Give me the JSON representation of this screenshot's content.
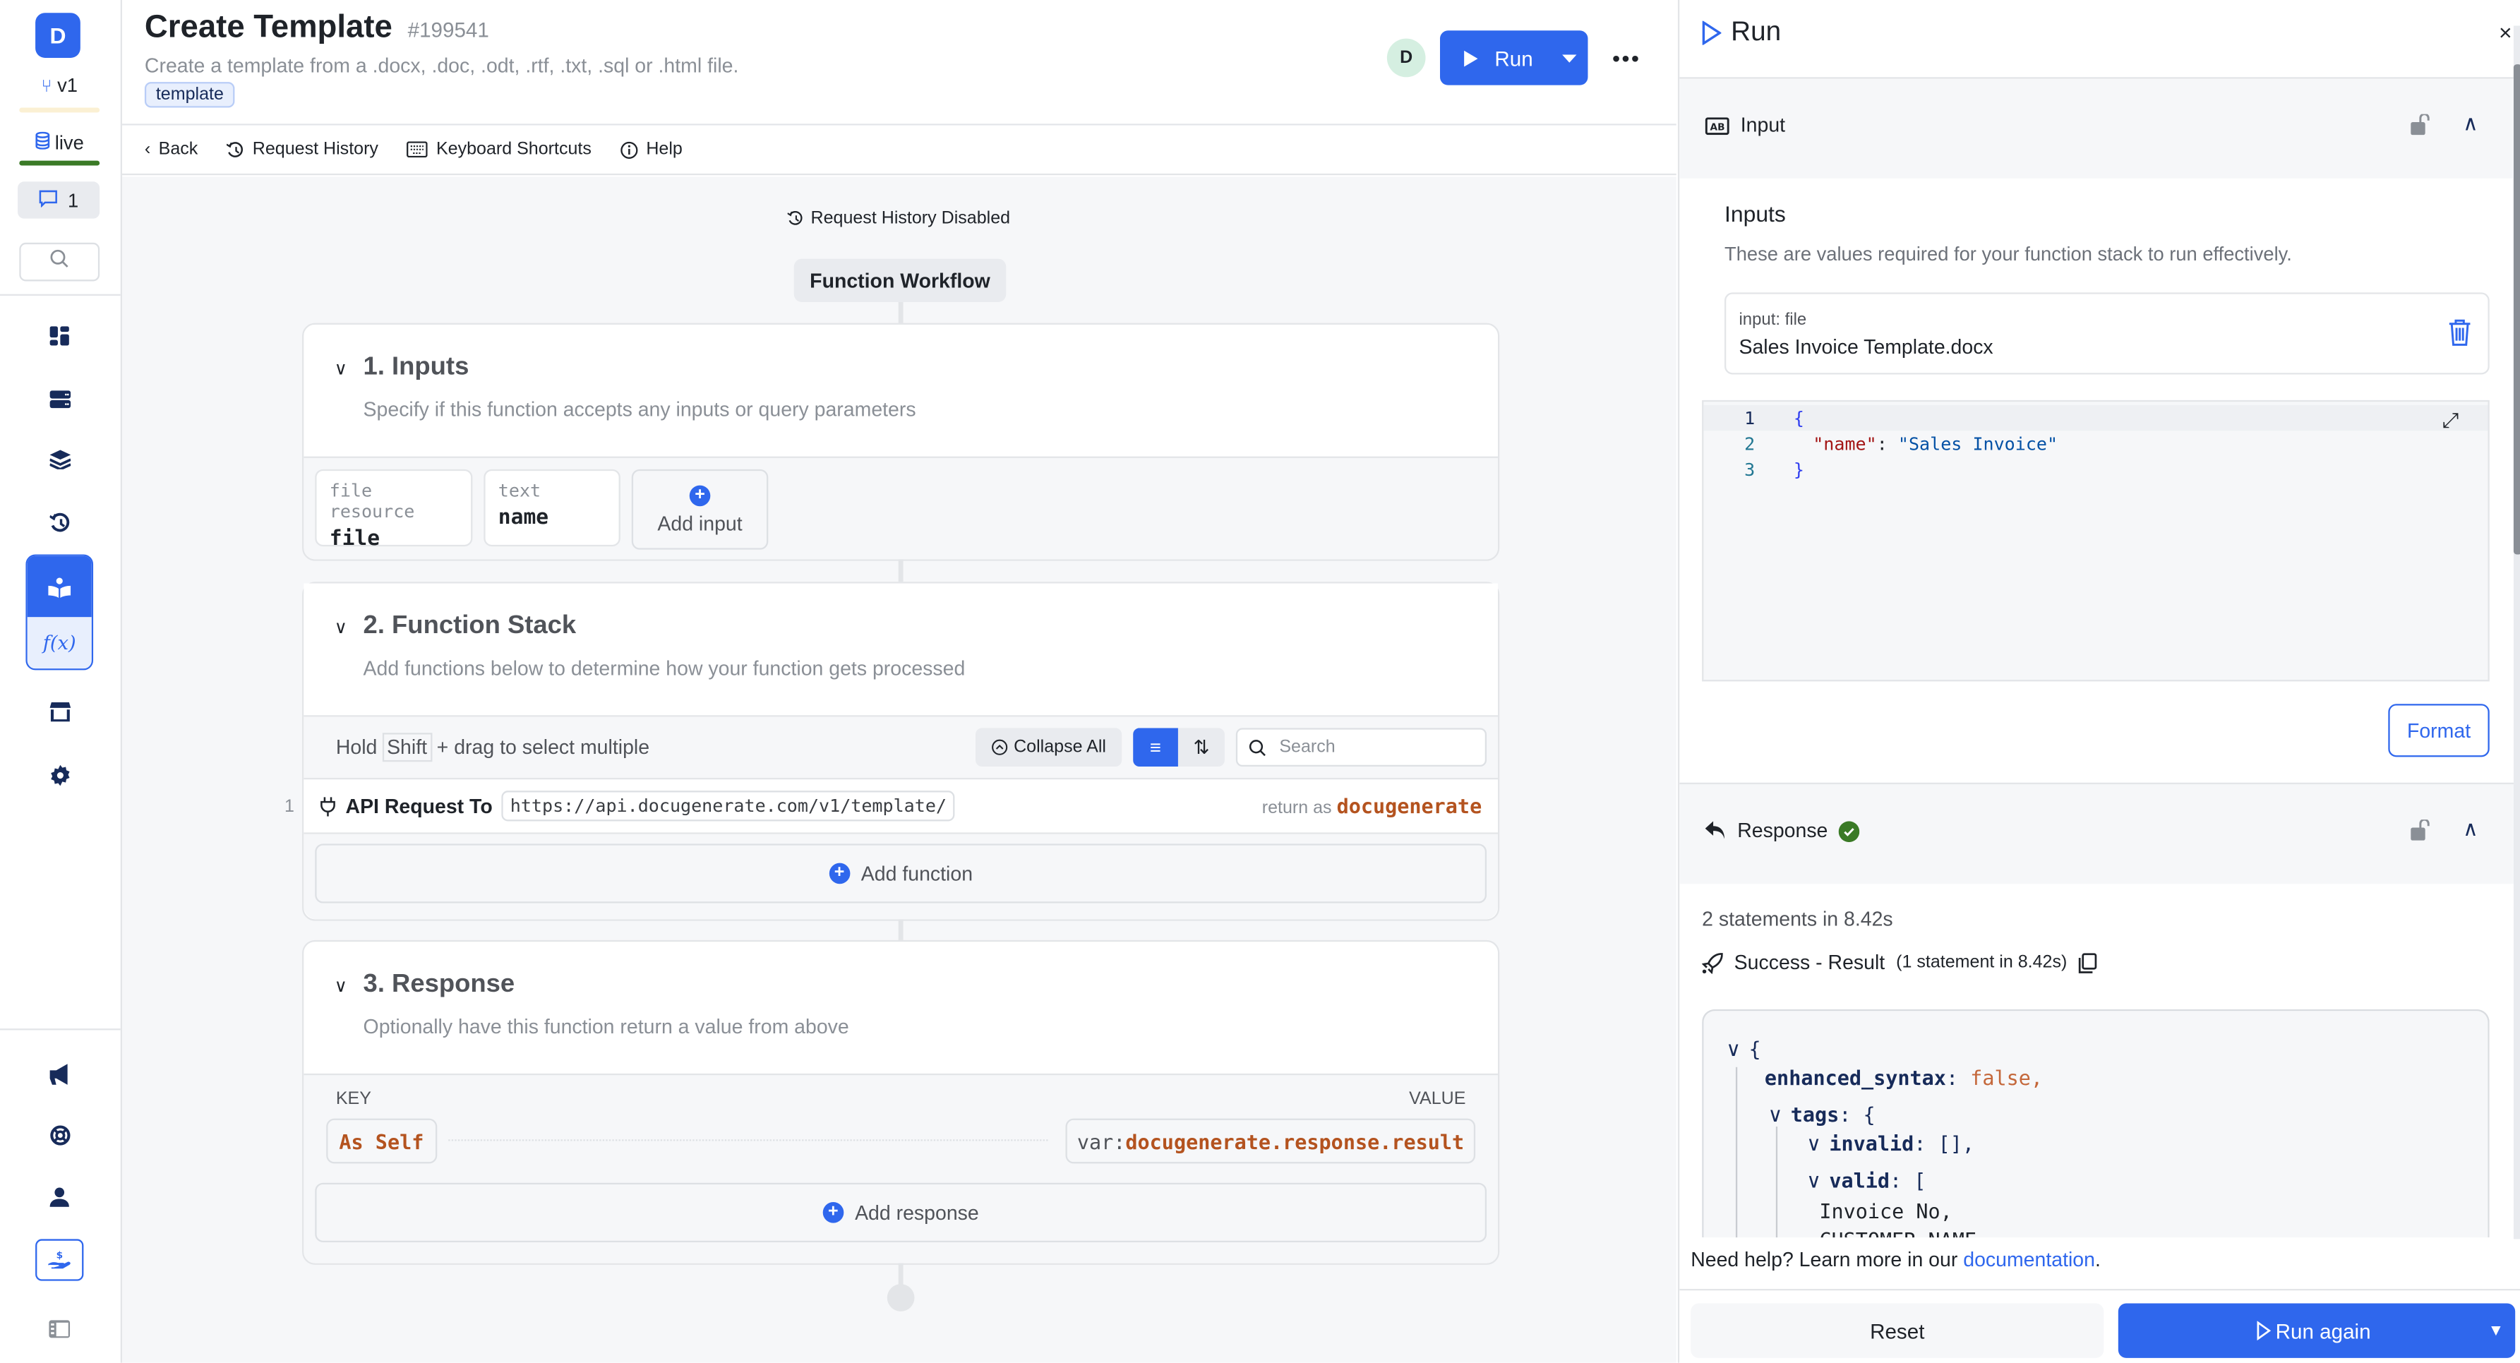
{
  "sidebar": {
    "logo_letter": "D",
    "branch": "v1",
    "environment": "live",
    "comments_count": "1",
    "colors": {
      "accent": "#2f67ed",
      "branch_bar": "#fbf0d3",
      "env_bar": "#3a7a26"
    },
    "nav_items": [
      {
        "name": "dashboard-icon"
      },
      {
        "name": "database-icon"
      },
      {
        "name": "layers-icon"
      },
      {
        "name": "history-icon"
      },
      {
        "name": "library-icon",
        "active": true
      },
      {
        "name": "function-icon",
        "active": true,
        "label": "f(x)"
      },
      {
        "name": "marketplace-icon"
      },
      {
        "name": "settings-icon"
      }
    ],
    "bottom_items": [
      {
        "name": "announcements-icon"
      },
      {
        "name": "support-icon"
      },
      {
        "name": "account-icon"
      },
      {
        "name": "billing-icon"
      },
      {
        "name": "panel-toggle-icon"
      }
    ]
  },
  "header": {
    "title": "Create Template",
    "id": "#199541",
    "description": "Create a template from a .docx, .doc, .odt, .rtf, .txt, .sql or .html file.",
    "tag": "template",
    "avatar_letter": "D",
    "run_label": "Run",
    "more_label": "•••"
  },
  "toolbar": {
    "back": "Back",
    "request_history": "Request History",
    "keyboard_shortcuts": "Keyboard Shortcuts",
    "help": "Help"
  },
  "canvas": {
    "request_history_status": "Request History Disabled",
    "workflow_label": "Function Workflow",
    "inputs_section": {
      "title": "1. Inputs",
      "description": "Specify if this function accepts any inputs or query parameters",
      "inputs": [
        {
          "type": "file resource",
          "name": "file"
        },
        {
          "type": "text",
          "name": "name"
        }
      ],
      "add_label": "Add input"
    },
    "function_stack_section": {
      "title": "2. Function Stack",
      "description": "Add functions below to determine how your function gets processed",
      "hint_prefix": "Hold",
      "hint_key": "Shift",
      "hint_suffix": "+ drag to select multiple",
      "collapse_all": "Collapse All",
      "search_placeholder": "Search",
      "functions": [
        {
          "index": "1",
          "label": "API Request To",
          "url": "https://api.docugenerate.com/v1/template/",
          "return_prefix": "return as",
          "return_var": "docugenerate"
        }
      ],
      "add_label": "Add function"
    },
    "response_section": {
      "title": "3. Response",
      "description": "Optionally have this function return a value from above",
      "key_header": "KEY",
      "value_header": "VALUE",
      "rows": [
        {
          "key": "As Self",
          "value_prefix": "var:",
          "value": "docugenerate.response.result"
        }
      ],
      "add_label": "Add response"
    }
  },
  "run_panel": {
    "title": "Run",
    "close_label": "×",
    "input_section": {
      "label": "Input",
      "heading": "Inputs",
      "description": "These are values required for your function stack to run effectively.",
      "file_input": {
        "label": "input: file",
        "value": "Sales Invoice Template.docx"
      },
      "editor_lines": [
        {
          "num": "1",
          "text": "{"
        },
        {
          "num": "2",
          "key": "\"name\"",
          "sep": ": ",
          "value": "\"Sales Invoice\""
        },
        {
          "num": "3",
          "text": "}"
        }
      ],
      "format_label": "Format"
    },
    "response_section": {
      "label": "Response",
      "status": "success",
      "summary": "2 statements in 8.42s",
      "result_label": "Success - Result",
      "result_detail": "(1 statement in 8.42s)",
      "result_lines": [
        {
          "toggle": "∨",
          "text": "{"
        },
        {
          "key": "enhanced_syntax",
          "value": "false,"
        },
        {
          "toggle": "∨",
          "key": "tags",
          "text": ": {"
        },
        {
          "toggle": "∨",
          "key": "invalid",
          "text": ": [],"
        },
        {
          "toggle": "∨",
          "key": "valid",
          "text": ": ["
        },
        {
          "text": "Invoice No,"
        },
        {
          "text": "CUSTOMER_NAME,"
        }
      ]
    },
    "help_prefix": "Need help? Learn more in our",
    "help_link": "documentation",
    "help_suffix": ".",
    "reset_label": "Reset",
    "run_again_label": "Run again"
  }
}
